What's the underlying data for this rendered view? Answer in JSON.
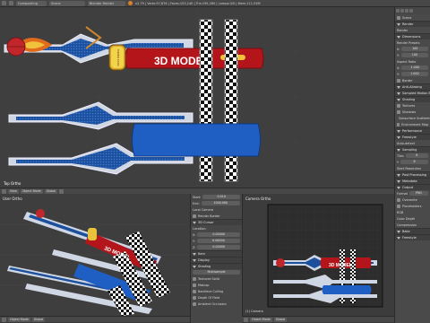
{
  "topbar": {
    "editor_type": "Compositing",
    "scene_name": "Scene",
    "engine": "Blender Render",
    "stats": "v2.79 | Verts:97,876 | Faces:103,140 | Tris:195,260 | Lamps:0/0 | Mem:111.53M"
  },
  "stickers": {
    "title": "3D MODEL",
    "badge_text": "TURBO STAR"
  },
  "top_viewport": {
    "mode_label": "Object Mode",
    "shading_label": "Global",
    "view_label": "Top Ortho"
  },
  "properties_right": {
    "scene_label": "Scene",
    "render_label": "Render",
    "items": [
      {
        "type": "section",
        "label": "Render"
      },
      {
        "type": "row",
        "label": "Render",
        "value": ""
      },
      {
        "type": "section",
        "label": "Dimensions"
      },
      {
        "type": "row",
        "label": "Render Presets",
        "value": ""
      },
      {
        "type": "row",
        "label": "X:",
        "value": "100"
      },
      {
        "type": "row",
        "label": "Y:",
        "value": "100"
      },
      {
        "type": "row",
        "label": "Aspect Ratio",
        "value": ""
      },
      {
        "type": "row",
        "label": "X:",
        "value": "1.000"
      },
      {
        "type": "row",
        "label": "Y:",
        "value": "1.000"
      },
      {
        "type": "check",
        "label": "Border",
        "value": ""
      },
      {
        "type": "section",
        "label": "Anti-Aliasing"
      },
      {
        "type": "section",
        "label": "Sampled Motion Blur"
      },
      {
        "type": "section",
        "label": "Shading"
      },
      {
        "type": "check",
        "label": "Textures",
        "value": ""
      },
      {
        "type": "check",
        "label": "Shadows",
        "value": ""
      },
      {
        "type": "check",
        "label": "Subsurface Scattering",
        "value": ""
      },
      {
        "type": "check",
        "label": "Environment Map",
        "value": ""
      },
      {
        "type": "section",
        "label": "Performance"
      },
      {
        "type": "section",
        "label": "Freestyle"
      },
      {
        "type": "row",
        "label": "Auto-detect",
        "value": ""
      },
      {
        "type": "section",
        "label": "Sampling"
      },
      {
        "type": "row",
        "label": "Tiles",
        "value": "8"
      },
      {
        "type": "row",
        "label": "Y",
        "value": "8"
      },
      {
        "type": "row",
        "label": "Start Resolution",
        "value": ""
      },
      {
        "type": "section",
        "label": "Post Processing"
      },
      {
        "type": "section",
        "label": "Metadata"
      },
      {
        "type": "section",
        "label": "Output"
      },
      {
        "type": "row",
        "label": "Format",
        "value": "PNG"
      },
      {
        "type": "check",
        "label": "Overwrite",
        "value": ""
      },
      {
        "type": "check",
        "label": "Placeholders",
        "value": ""
      },
      {
        "type": "row",
        "label": "RGB",
        "value": ""
      },
      {
        "type": "row",
        "label": "Color Depth",
        "value": ""
      },
      {
        "type": "row",
        "label": "Compression",
        "value": ""
      },
      {
        "type": "section",
        "label": "Bake"
      },
      {
        "type": "section",
        "label": "Freestyle"
      }
    ]
  },
  "bottom_left_viewport": {
    "view_label": "User Ortho",
    "mode_label": "Object Mode",
    "shading_label": "Global"
  },
  "n_panel": {
    "start_label": "Start:",
    "start_value": "0.010",
    "end_label": "End:",
    "end_value": "1000.000",
    "local_camera_label": "Local Camera",
    "render_border_label": "Render Border",
    "cursor_section": "3D Cursor",
    "location_label": "Location:",
    "x_value": "0.00000",
    "y_value": "0.00000",
    "z_value": "0.00000",
    "items_section": "Item",
    "display_section": "Display",
    "shading_section": "Shading",
    "multisample_label": "Multisample",
    "textured_solid": "Textured Solid",
    "matcap": "Matcap",
    "backface_culling": "Backface Culling",
    "depth_of_field": "Depth Of Field",
    "ambient_occlusion": "Ambient Occlusion"
  },
  "camera_viewport": {
    "view_label": "Camera Ortho",
    "mode_label": "Object Mode",
    "shading_label": "Global",
    "object_name": "(1) Camera"
  },
  "colors": {
    "red": "#b3151b",
    "blue": "#1f5fc4",
    "accent": "#5680c2"
  }
}
